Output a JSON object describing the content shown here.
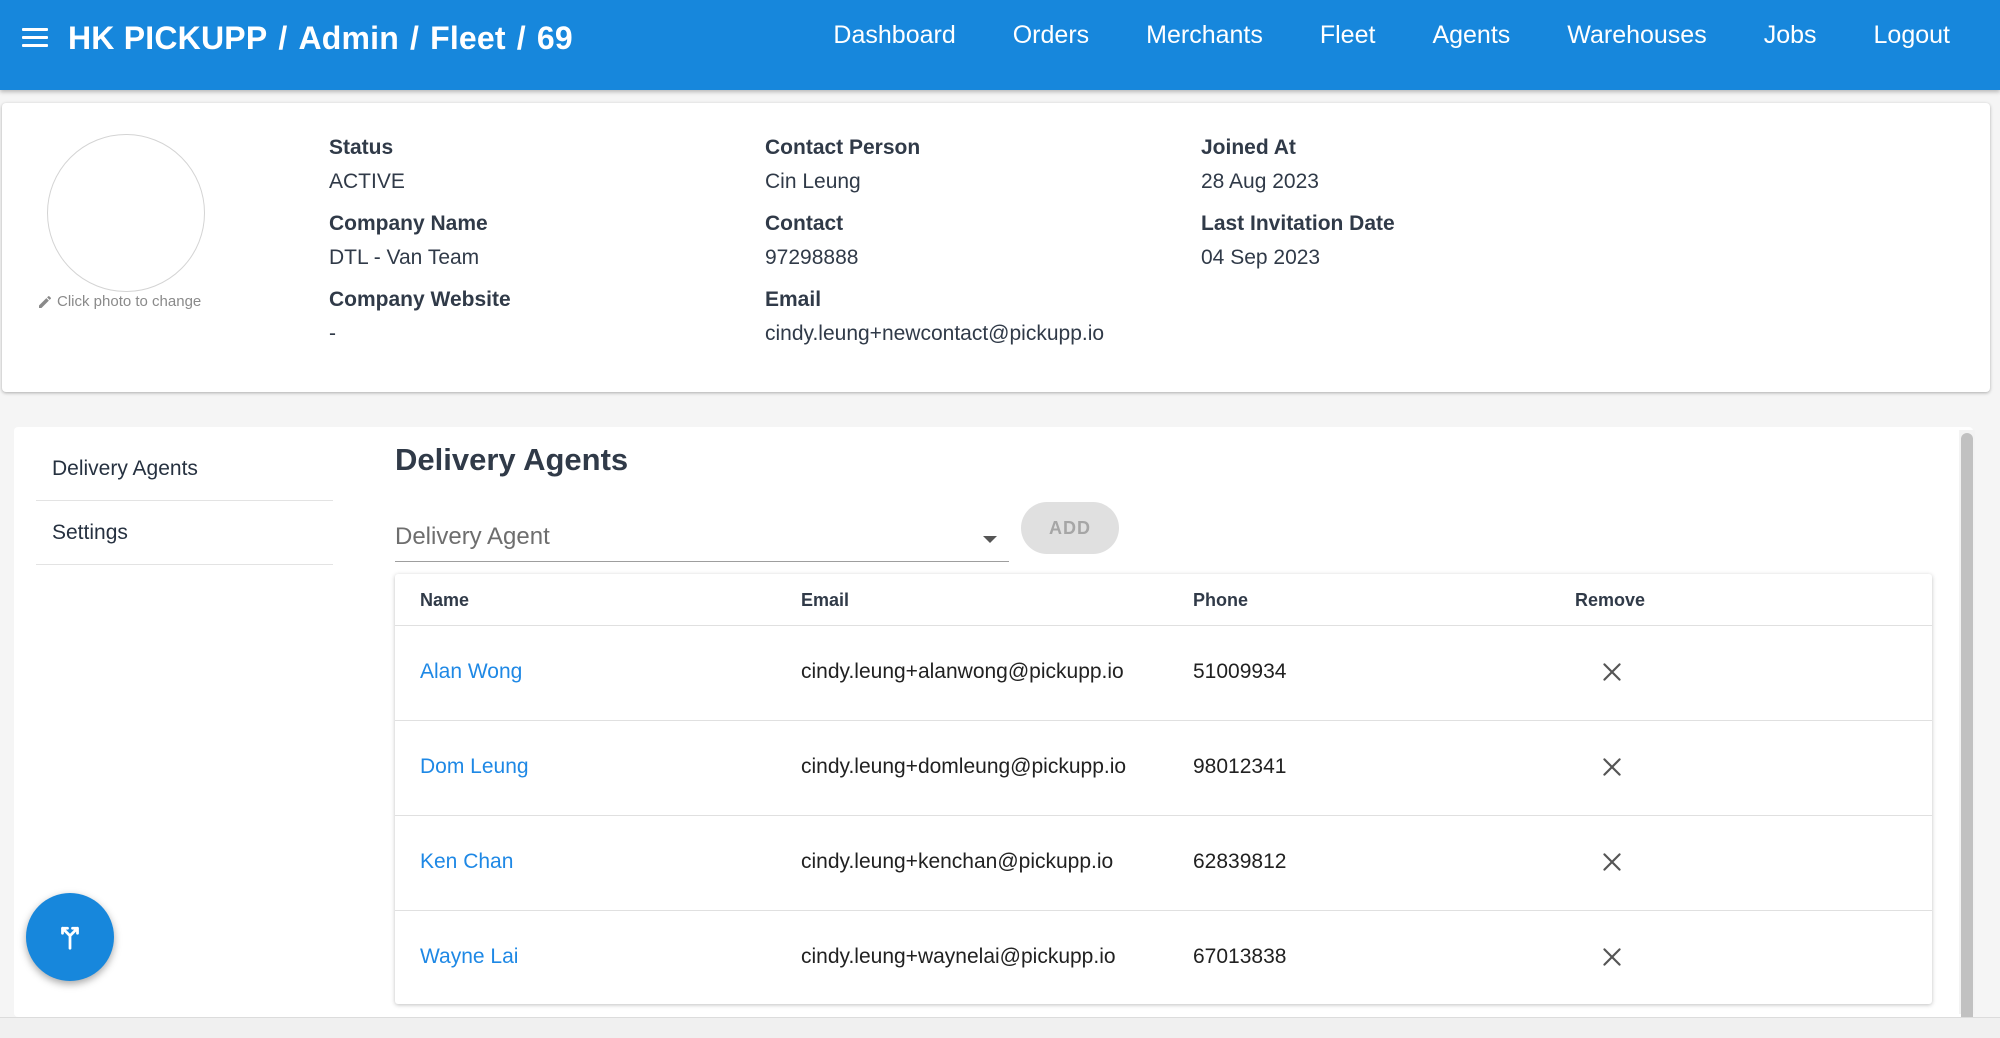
{
  "header": {
    "breadcrumb": [
      "HK PICKUPP",
      "Admin",
      "Fleet",
      "69"
    ],
    "breadcrumb_separator": "/",
    "nav": [
      "Dashboard",
      "Orders",
      "Merchants",
      "Fleet",
      "Agents",
      "Warehouses",
      "Jobs",
      "Logout"
    ],
    "accent_color": "#1787dc"
  },
  "profile": {
    "photo_hint": "Click photo to change",
    "status_label": "Status",
    "status_value": "ACTIVE",
    "company_name_label": "Company Name",
    "company_name_value": "DTL - Van Team",
    "company_website_label": "Company Website",
    "company_website_value": "-",
    "contact_person_label": "Contact Person",
    "contact_person_value": "Cin Leung",
    "contact_label": "Contact",
    "contact_value": "97298888",
    "email_label": "Email",
    "email_value": "cindy.leung+newcontact@pickupp.io",
    "joined_at_label": "Joined At",
    "joined_at_value": "28 Aug 2023",
    "last_invitation_label": "Last Invitation Date",
    "last_invitation_value": "04 Sep 2023"
  },
  "sidebar": {
    "items": [
      "Delivery Agents",
      "Settings"
    ]
  },
  "agents": {
    "title": "Delivery Agents",
    "select_placeholder": "Delivery Agent",
    "add_label": "ADD",
    "columns": [
      "Name",
      "Email",
      "Phone",
      "Remove"
    ],
    "rows": [
      {
        "name": "Alan Wong",
        "email": "cindy.leung+alanwong@pickupp.io",
        "phone": "51009934"
      },
      {
        "name": "Dom Leung",
        "email": "cindy.leung+domleung@pickupp.io",
        "phone": "98012341"
      },
      {
        "name": "Ken Chan",
        "email": "cindy.leung+kenchan@pickupp.io",
        "phone": "62839812"
      },
      {
        "name": "Wayne Lai",
        "email": "cindy.leung+waynelai@pickupp.io",
        "phone": "67013838"
      }
    ]
  },
  "icons": {
    "menu": "menu-icon",
    "pencil": "pencil-icon",
    "dropdown": "chevron-down-icon",
    "remove": "close-icon",
    "fab": "merge-icon"
  }
}
